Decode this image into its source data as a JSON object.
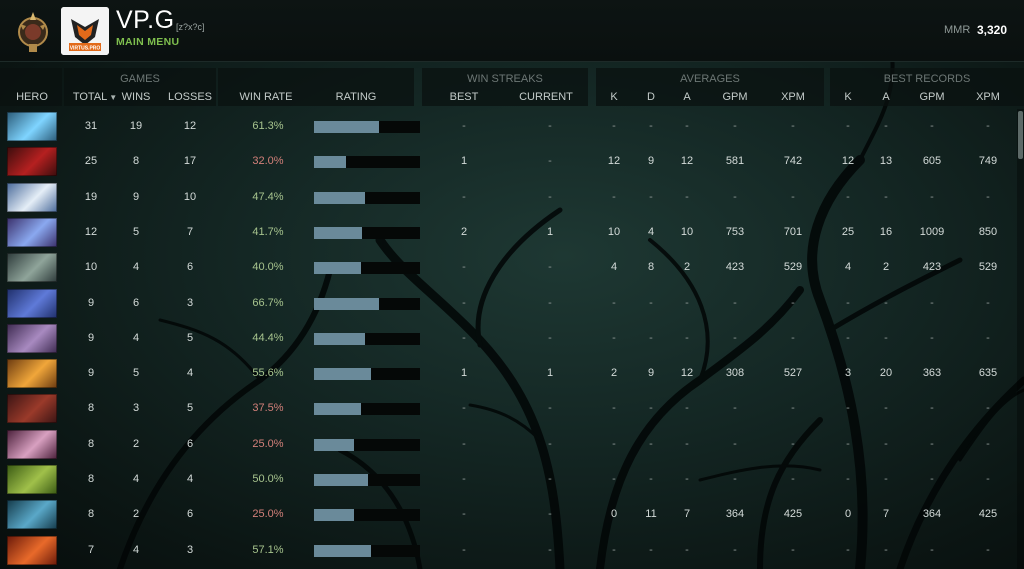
{
  "header": {
    "player_name": "VP.G",
    "player_tag": "[z?x?c]",
    "main_menu": "MAIN MENU",
    "mmr_label": "MMR",
    "mmr_value": "3,320",
    "team_logo_text": "VIRTUS.PRO"
  },
  "groups": {
    "games": "GAMES",
    "win_streaks": "WIN STREAKS",
    "averages": "AVERAGES",
    "best_records": "BEST RECORDS"
  },
  "columns": {
    "hero": "HERO",
    "total": "TOTAL",
    "wins": "WINS",
    "losses": "LOSSES",
    "win_rate": "WIN RATE",
    "rating": "RATING",
    "best": "BEST",
    "current": "CURRENT",
    "avg_k": "K",
    "avg_d": "D",
    "avg_a": "A",
    "avg_gpm": "GPM",
    "avg_xpm": "XPM",
    "rec_k": "K",
    "rec_a": "A",
    "rec_gpm": "GPM",
    "rec_xpm": "XPM"
  },
  "colors": {
    "winrate_good": "#a7c48e",
    "winrate_bad": "#d4807a",
    "rating_bar": "#6a8a9a",
    "accent_green": "#7fbf4e"
  },
  "rows": [
    {
      "hero_icon": "blue-spirit-hero-icon",
      "hero_color": [
        "#2b5b78",
        "#7fd4ff"
      ],
      "total": "31",
      "wins": "19",
      "losses": "12",
      "win_rate": "61.3%",
      "rating": 0.61,
      "best": "-",
      "current": "-",
      "k": "-",
      "d": "-",
      "a": "-",
      "gpm": "-",
      "xpm": "-",
      "rk": "-",
      "ra": "-",
      "rgpm": "-",
      "rxpm": "-"
    },
    {
      "hero_icon": "red-demon-hero-icon",
      "hero_color": [
        "#3a0d0d",
        "#b52020"
      ],
      "total": "25",
      "wins": "8",
      "losses": "17",
      "win_rate": "32.0%",
      "rating": 0.3,
      "best": "1",
      "current": "-",
      "k": "12",
      "d": "9",
      "a": "12",
      "gpm": "581",
      "xpm": "742",
      "rk": "12",
      "ra": "13",
      "rgpm": "605",
      "rxpm": "749"
    },
    {
      "hero_icon": "white-mage-hero-icon",
      "hero_color": [
        "#4a6a9a",
        "#e5eef7"
      ],
      "total": "19",
      "wins": "9",
      "losses": "10",
      "win_rate": "47.4%",
      "rating": 0.48,
      "best": "-",
      "current": "-",
      "k": "-",
      "d": "-",
      "a": "-",
      "gpm": "-",
      "xpm": "-",
      "rk": "-",
      "ra": "-",
      "rgpm": "-",
      "rxpm": "-"
    },
    {
      "hero_icon": "purple-orb-hero-icon",
      "hero_color": [
        "#3a2f6a",
        "#8aa8ef"
      ],
      "total": "12",
      "wins": "5",
      "losses": "7",
      "win_rate": "41.7%",
      "rating": 0.45,
      "best": "2",
      "current": "1",
      "k": "10",
      "d": "4",
      "a": "10",
      "gpm": "753",
      "xpm": "701",
      "rk": "25",
      "ra": "16",
      "rgpm": "1009",
      "rxpm": "850"
    },
    {
      "hero_icon": "hooded-hero-icon",
      "hero_color": [
        "#2d3a3a",
        "#8fa49a"
      ],
      "total": "10",
      "wins": "4",
      "losses": "6",
      "win_rate": "40.0%",
      "rating": 0.44,
      "best": "-",
      "current": "-",
      "k": "4",
      "d": "8",
      "a": "2",
      "gpm": "423",
      "xpm": "529",
      "rk": "4",
      "ra": "2",
      "rgpm": "423",
      "rxpm": "529"
    },
    {
      "hero_icon": "arcane-hero-icon",
      "hero_color": [
        "#1f2f6a",
        "#5f7ad8"
      ],
      "total": "9",
      "wins": "6",
      "losses": "3",
      "win_rate": "66.7%",
      "rating": 0.61,
      "best": "-",
      "current": "-",
      "k": "-",
      "d": "-",
      "a": "-",
      "gpm": "-",
      "xpm": "-",
      "rk": "-",
      "ra": "-",
      "rgpm": "-",
      "rxpm": "-"
    },
    {
      "hero_icon": "masked-assassin-hero-icon",
      "hero_color": [
        "#3d2a50",
        "#a88ac0"
      ],
      "total": "9",
      "wins": "4",
      "losses": "5",
      "win_rate": "44.4%",
      "rating": 0.48,
      "best": "-",
      "current": "-",
      "k": "-",
      "d": "-",
      "a": "-",
      "gpm": "-",
      "xpm": "-",
      "rk": "-",
      "ra": "-",
      "rgpm": "-",
      "rxpm": "-"
    },
    {
      "hero_icon": "fire-mage-hero-icon",
      "hero_color": [
        "#6a3a10",
        "#f0a63a"
      ],
      "total": "9",
      "wins": "5",
      "losses": "4",
      "win_rate": "55.6%",
      "rating": 0.54,
      "best": "1",
      "current": "1",
      "k": "2",
      "d": "9",
      "a": "12",
      "gpm": "308",
      "xpm": "527",
      "rk": "3",
      "ra": "20",
      "rgpm": "363",
      "rxpm": "635"
    },
    {
      "hero_icon": "axe-warrior-hero-icon",
      "hero_color": [
        "#3a1414",
        "#9a3a2a"
      ],
      "total": "8",
      "wins": "3",
      "losses": "5",
      "win_rate": "37.5%",
      "rating": 0.44,
      "best": "-",
      "current": "-",
      "k": "-",
      "d": "-",
      "a": "-",
      "gpm": "-",
      "xpm": "-",
      "rk": "-",
      "ra": "-",
      "rgpm": "-",
      "rxpm": "-"
    },
    {
      "hero_icon": "pale-witch-hero-icon",
      "hero_color": [
        "#4a1f3a",
        "#d8a0c0"
      ],
      "total": "8",
      "wins": "2",
      "losses": "6",
      "win_rate": "25.0%",
      "rating": 0.38,
      "best": "-",
      "current": "-",
      "k": "-",
      "d": "-",
      "a": "-",
      "gpm": "-",
      "xpm": "-",
      "rk": "-",
      "ra": "-",
      "rgpm": "-",
      "rxpm": "-"
    },
    {
      "hero_icon": "goblin-hero-icon",
      "hero_color": [
        "#3a5a14",
        "#a0c04a"
      ],
      "total": "8",
      "wins": "4",
      "losses": "4",
      "win_rate": "50.0%",
      "rating": 0.51,
      "best": "-",
      "current": "-",
      "k": "-",
      "d": "-",
      "a": "-",
      "gpm": "-",
      "xpm": "-",
      "rk": "-",
      "ra": "-",
      "rgpm": "-",
      "rxpm": "-"
    },
    {
      "hero_icon": "phantom-hero-icon",
      "hero_color": [
        "#143a4a",
        "#5aa8c8"
      ],
      "total": "8",
      "wins": "2",
      "losses": "6",
      "win_rate": "25.0%",
      "rating": 0.38,
      "best": "-",
      "current": "-",
      "k": "0",
      "d": "11",
      "a": "7",
      "gpm": "364",
      "xpm": "425",
      "rk": "0",
      "ra": "7",
      "rgpm": "364",
      "rxpm": "425"
    },
    {
      "hero_icon": "ember-hero-icon",
      "hero_color": [
        "#6a1a0a",
        "#e86a2a"
      ],
      "total": "7",
      "wins": "4",
      "losses": "3",
      "win_rate": "57.1%",
      "rating": 0.54,
      "best": "-",
      "current": "-",
      "k": "-",
      "d": "-",
      "a": "-",
      "gpm": "-",
      "xpm": "-",
      "rk": "-",
      "ra": "-",
      "rgpm": "-",
      "rxpm": "-"
    }
  ]
}
